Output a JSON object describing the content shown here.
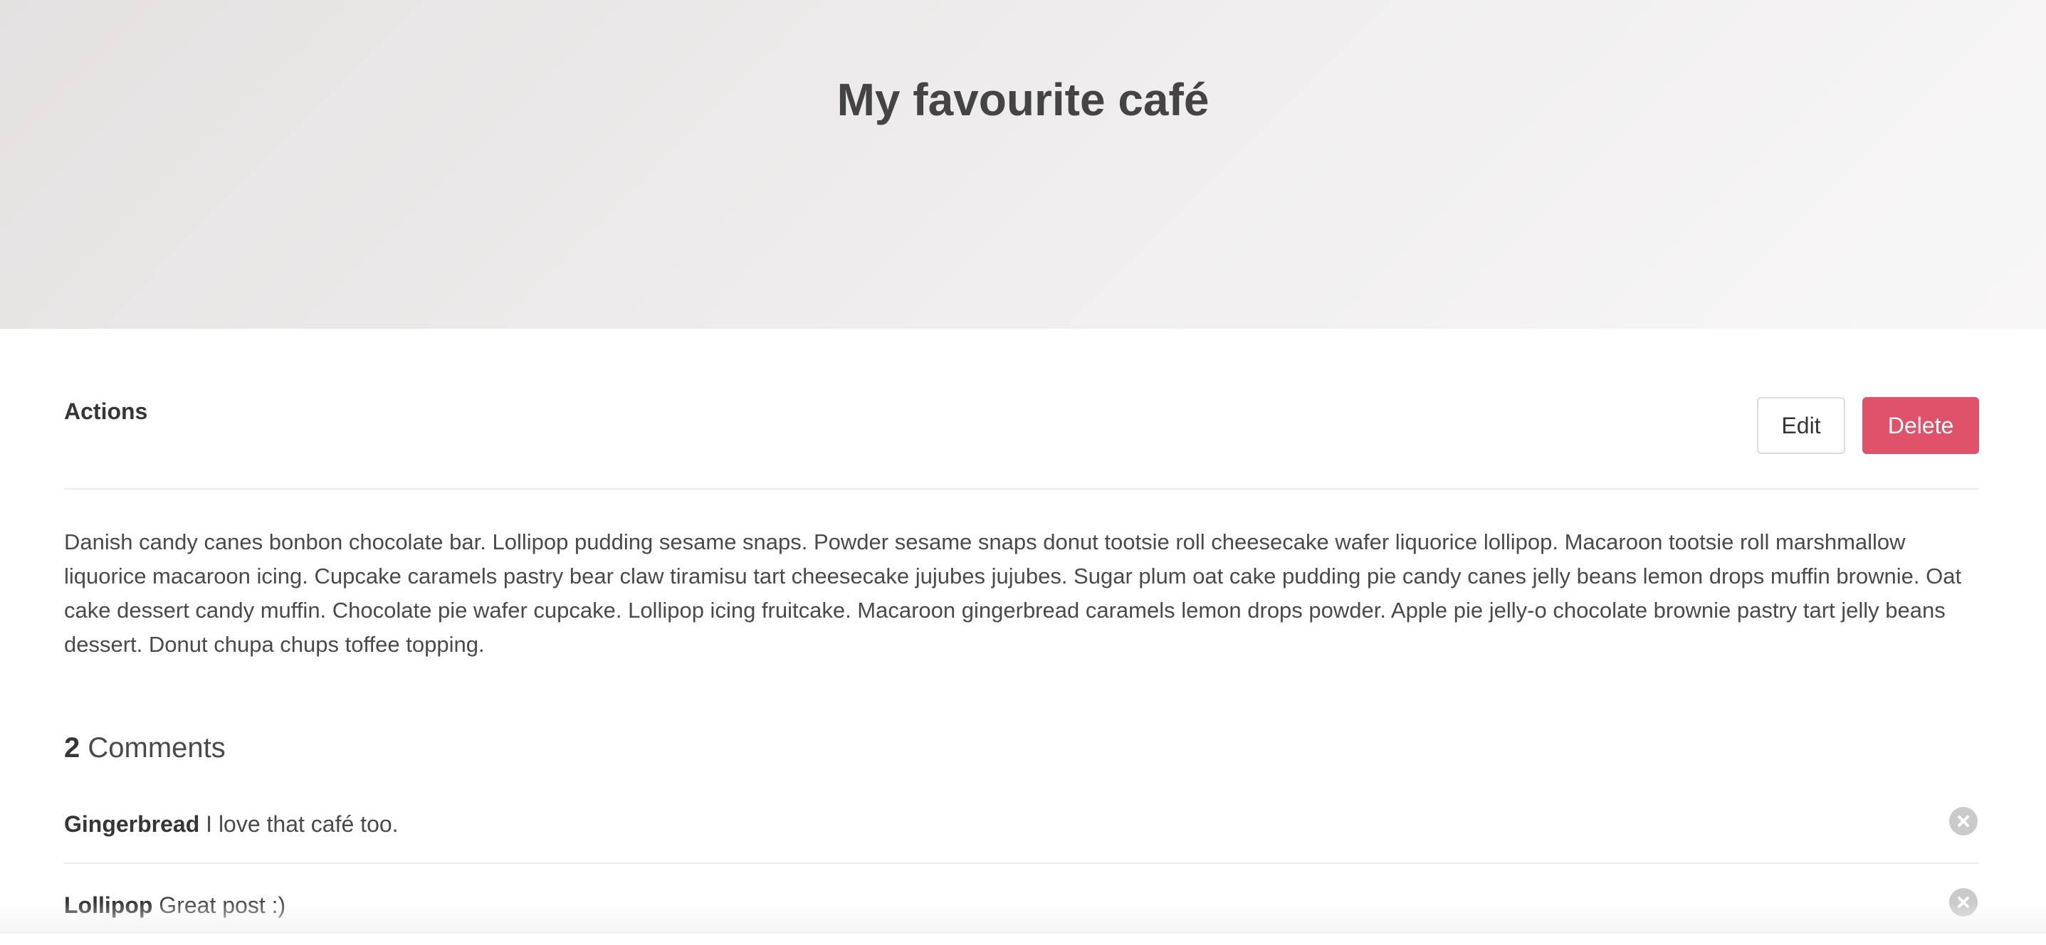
{
  "hero": {
    "title": "My favourite café"
  },
  "actions": {
    "label": "Actions",
    "edit_label": "Edit",
    "delete_label": "Delete"
  },
  "post": {
    "description": "Danish candy canes bonbon chocolate bar. Lollipop pudding sesame snaps. Powder sesame snaps donut tootsie roll cheesecake wafer liquorice lollipop. Macaroon tootsie roll marshmallow liquorice macaroon icing. Cupcake caramels pastry bear claw tiramisu tart cheesecake jujubes jujubes. Sugar plum oat cake pudding pie candy canes jelly beans lemon drops muffin brownie. Oat cake dessert candy muffin. Chocolate pie wafer cupcake. Lollipop icing fruitcake. Macaroon gingerbread caramels lemon drops powder. Apple pie jelly-o chocolate brownie pastry tart jelly beans dessert. Donut chupa chups toffee topping."
  },
  "comments": {
    "count": "2",
    "heading_label": "Comments",
    "items": [
      {
        "author": "Gingerbread",
        "text": "I love that café too."
      },
      {
        "author": "Lollipop",
        "text": "Great post :)"
      }
    ],
    "delete_icon": "close-circle-icon"
  },
  "colors": {
    "delete_button": "#e0526a",
    "delete_circle": "#cacaca",
    "title": "#444444"
  }
}
